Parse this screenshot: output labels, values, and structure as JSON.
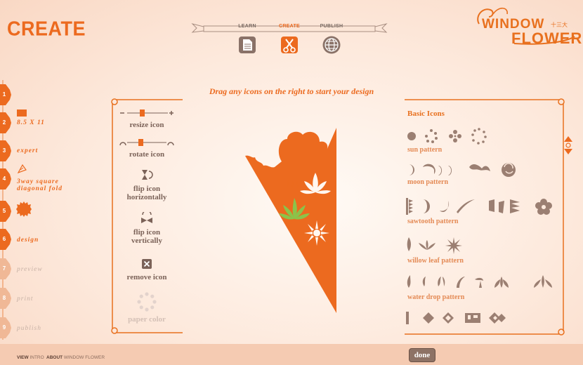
{
  "header": {
    "page_title": "CREATE",
    "nav": [
      {
        "label": "LEARN",
        "icon": "document-icon"
      },
      {
        "label": "CREATE",
        "icon": "scissors-icon"
      },
      {
        "label": "PUBLISH",
        "icon": "globe-icon"
      }
    ],
    "logo": {
      "line1": "WINDOW",
      "line2": "FLOWER"
    }
  },
  "steps": [
    {
      "num": "1",
      "text": "",
      "state": "done"
    },
    {
      "num": "2",
      "text": "8.5 X 11",
      "state": "done"
    },
    {
      "num": "3",
      "text": "expert",
      "state": "done"
    },
    {
      "num": "4",
      "text": "3way square diagonal fold",
      "state": "done"
    },
    {
      "num": "5",
      "text": "",
      "state": "done"
    },
    {
      "num": "6",
      "text": "design",
      "state": "active"
    },
    {
      "num": "7",
      "text": "preview",
      "state": "disabled"
    },
    {
      "num": "8",
      "text": "print",
      "state": "disabled"
    },
    {
      "num": "9",
      "text": "publish",
      "state": "disabled"
    }
  ],
  "tools": {
    "resize": "resize icon",
    "rotate": "rotate icon",
    "flip_h": "flip icon horizontally",
    "flip_v": "flip icon vertically",
    "remove": "remove icon",
    "paper_color": "paper color"
  },
  "instruction": "Drag any icons on the right to start your design",
  "icon_panel": {
    "heading": "Basic Icons",
    "patterns": [
      "sun pattern",
      "moon pattern",
      "sawtooth pattern",
      "willow leaf pattern",
      "water drop pattern"
    ]
  },
  "footer": {
    "view_label": "VIEW",
    "view_link": "INTRO",
    "about_label": "ABOUT",
    "about_link": "WINDOW FLOWER",
    "done_label": "done"
  },
  "colors": {
    "accent": "#ec6a1f",
    "muted": "#9b7f72",
    "background": "#fde9dc",
    "footer": "#f5cbb2"
  }
}
